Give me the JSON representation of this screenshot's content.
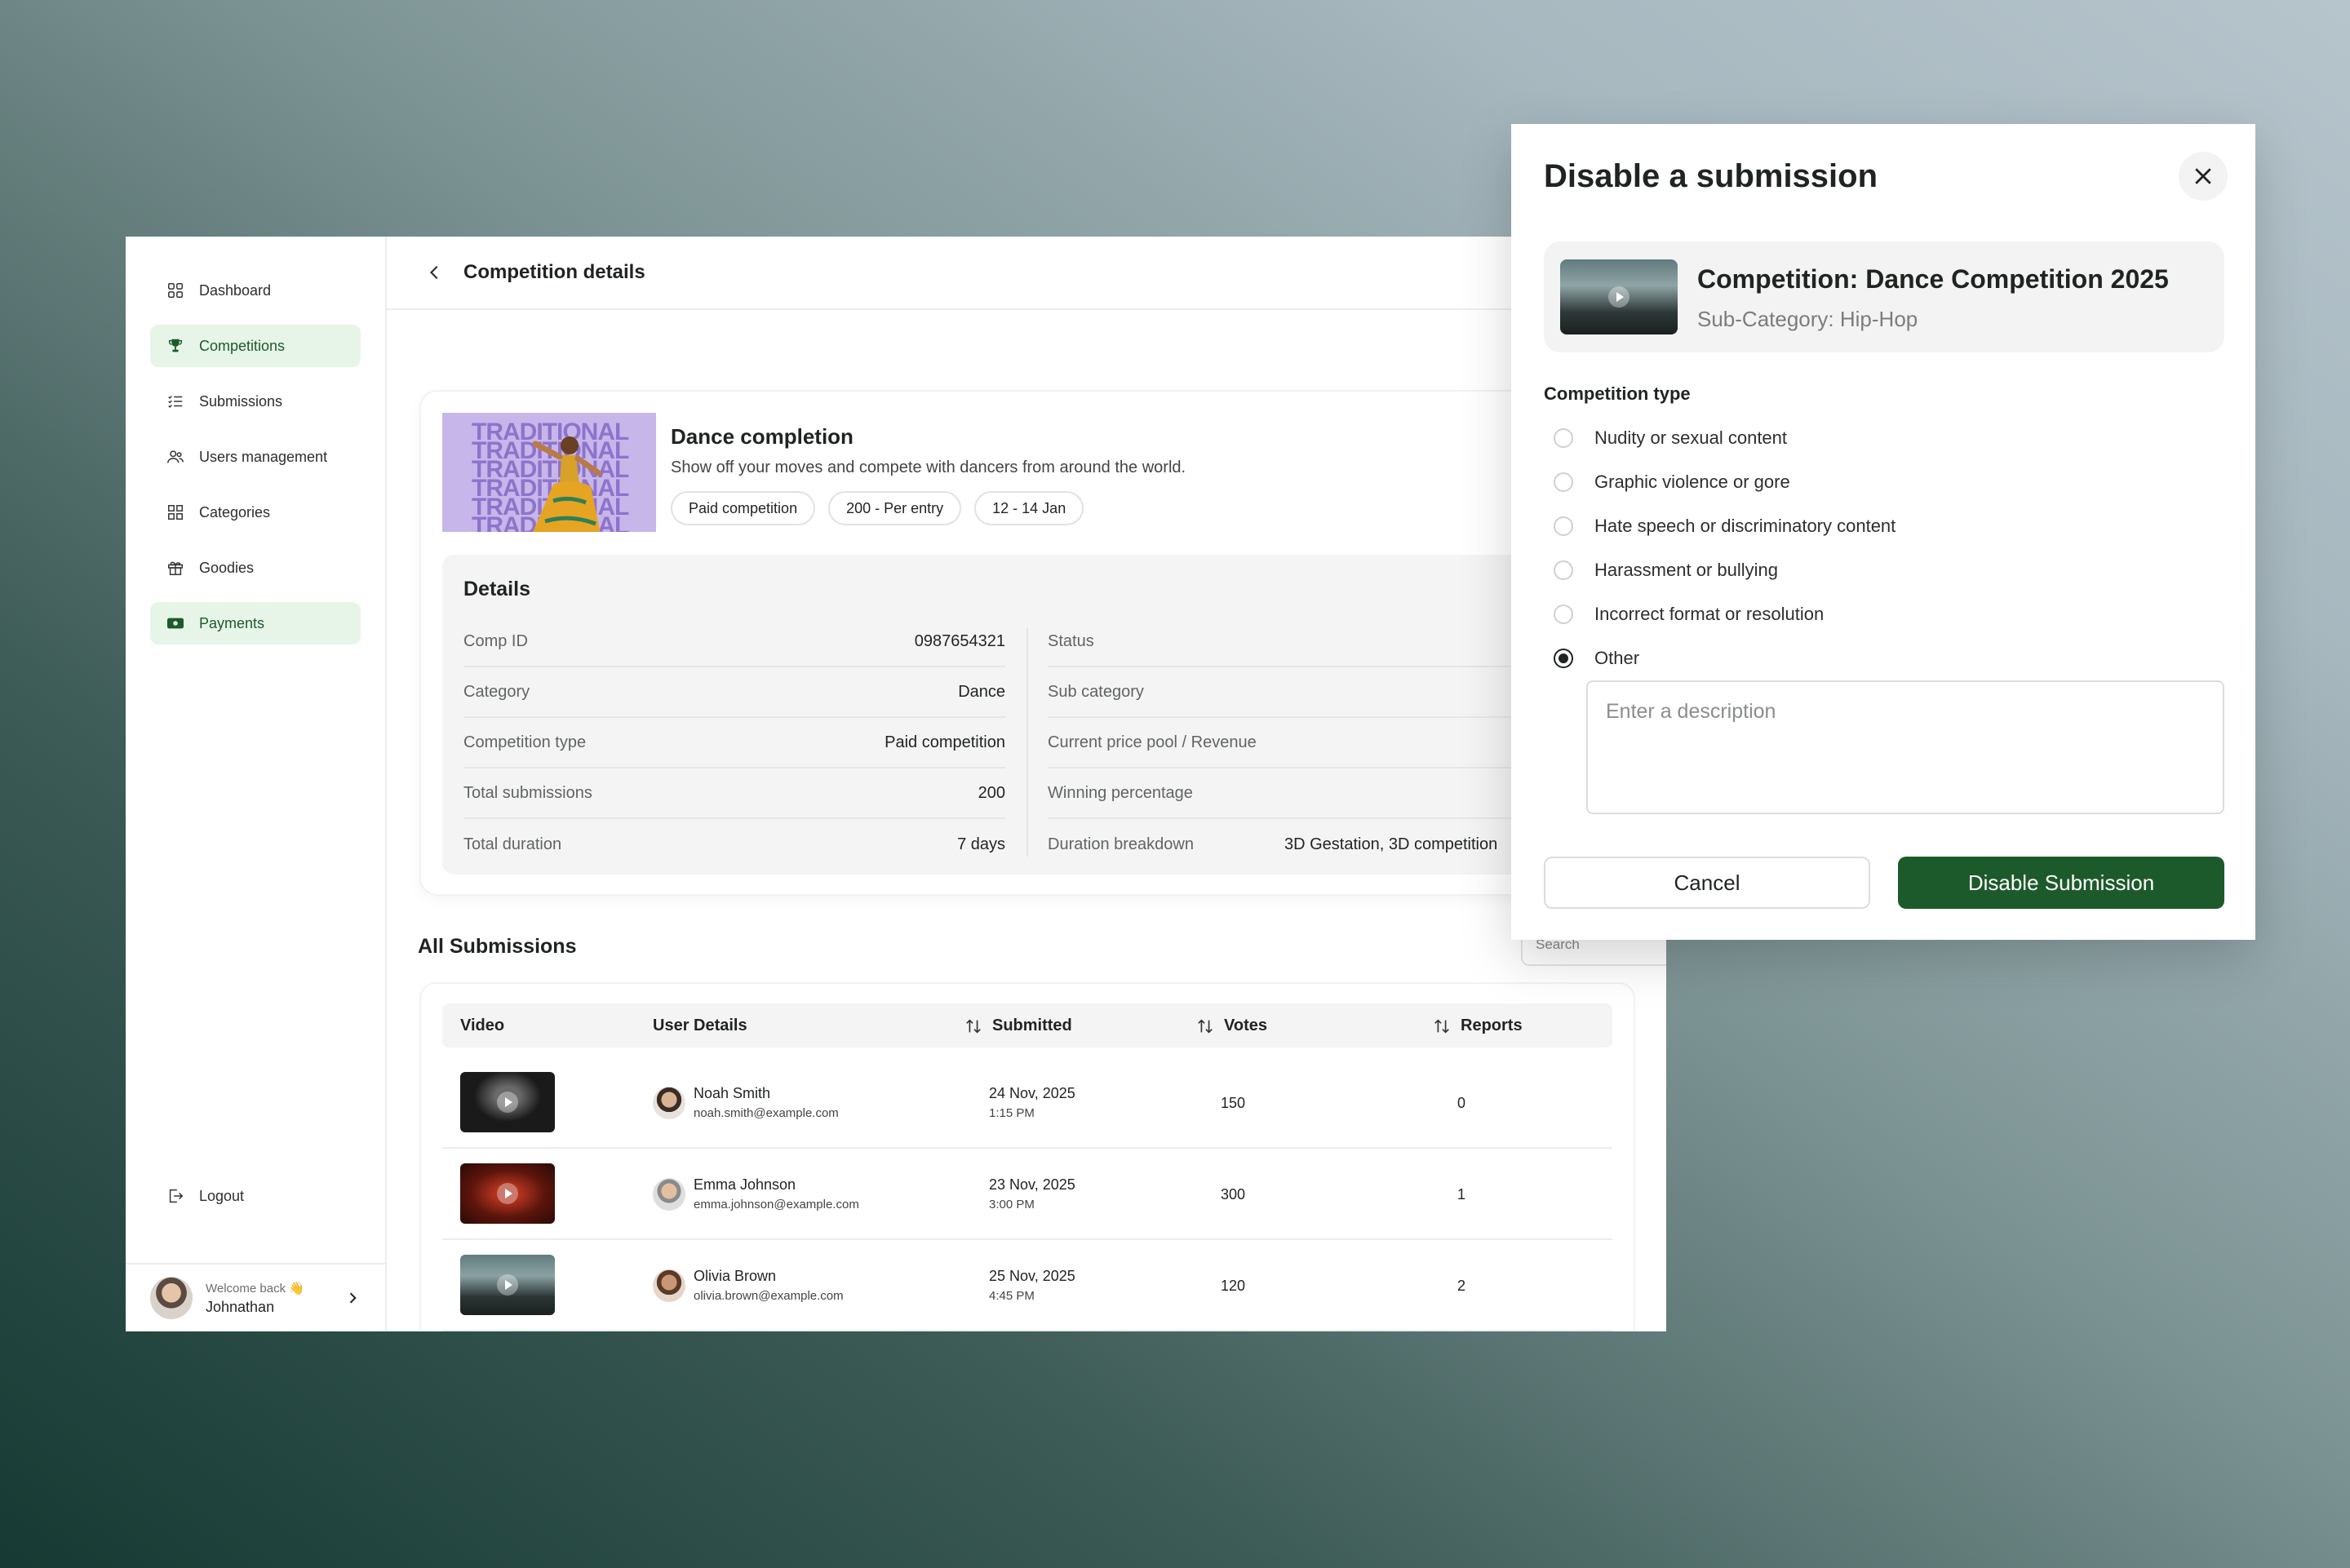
{
  "sidebar": {
    "items": [
      {
        "label": "Dashboard"
      },
      {
        "label": "Competitions"
      },
      {
        "label": "Submissions"
      },
      {
        "label": "Users management"
      },
      {
        "label": "Categories"
      },
      {
        "label": "Goodies"
      },
      {
        "label": "Payments"
      }
    ],
    "logout": "Logout",
    "welcome": "Welcome back 👋",
    "user": "Johnathan"
  },
  "page": {
    "title": "Competition details"
  },
  "competition": {
    "banner_word": "TRADITIONAL",
    "name": "Dance completion",
    "description": "Show off your moves and compete with dancers from around the world.",
    "chips": [
      "Paid competition",
      "200 - Per entry",
      "12 - 14 Jan"
    ]
  },
  "details": {
    "title": "Details",
    "left": [
      {
        "k": "Comp ID",
        "v": "0987654321"
      },
      {
        "k": "Category",
        "v": "Dance"
      },
      {
        "k": "Competition type",
        "v": "Paid competition"
      },
      {
        "k": "Total submissions",
        "v": "200"
      },
      {
        "k": "Total duration",
        "v": "7 days"
      }
    ],
    "right": [
      {
        "k": "Status",
        "v": ""
      },
      {
        "k": "Sub category",
        "v": ""
      },
      {
        "k": "Current price pool / Revenue",
        "v": ""
      },
      {
        "k": "Winning percentage",
        "v": ""
      },
      {
        "k": "Duration breakdown",
        "v": "3D Gestation, 3D competition"
      }
    ]
  },
  "submissions": {
    "title": "All Submissions",
    "search_placeholder": "Search",
    "headers": {
      "video": "Video",
      "user": "User Details",
      "submitted": "Submitted",
      "votes": "Votes",
      "reports": "Reports"
    },
    "rows": [
      {
        "name": "Noah Smith",
        "email": "noah.smith@example.com",
        "date": "24 Nov, 2025",
        "time": "1:15 PM",
        "votes": "150",
        "reports": "0"
      },
      {
        "name": "Emma Johnson",
        "email": "emma.johnson@example.com",
        "date": "23 Nov, 2025",
        "time": "3:00 PM",
        "votes": "300",
        "reports": "1"
      },
      {
        "name": "Olivia Brown",
        "email": "olivia.brown@example.com",
        "date": "25 Nov, 2025",
        "time": "4:45 PM",
        "votes": "120",
        "reports": "2"
      }
    ]
  },
  "modal": {
    "title": "Disable a submission",
    "competition": "Competition: Dance Competition 2025",
    "subcategory": "Sub-Category: Hip-Hop",
    "section_label": "Competition type",
    "options": [
      {
        "label": "Nudity or sexual content",
        "selected": false
      },
      {
        "label": "Graphic violence or gore",
        "selected": false
      },
      {
        "label": "Hate speech or discriminatory content",
        "selected": false
      },
      {
        "label": "Harassment or bullying",
        "selected": false
      },
      {
        "label": "Incorrect format or resolution",
        "selected": false
      },
      {
        "label": "Other",
        "selected": true
      }
    ],
    "description_placeholder": "Enter a description",
    "cancel": "Cancel",
    "confirm": "Disable Submission"
  },
  "colors": {
    "accent": "#1d5a2b",
    "active_bg": "#e7f5e8"
  }
}
